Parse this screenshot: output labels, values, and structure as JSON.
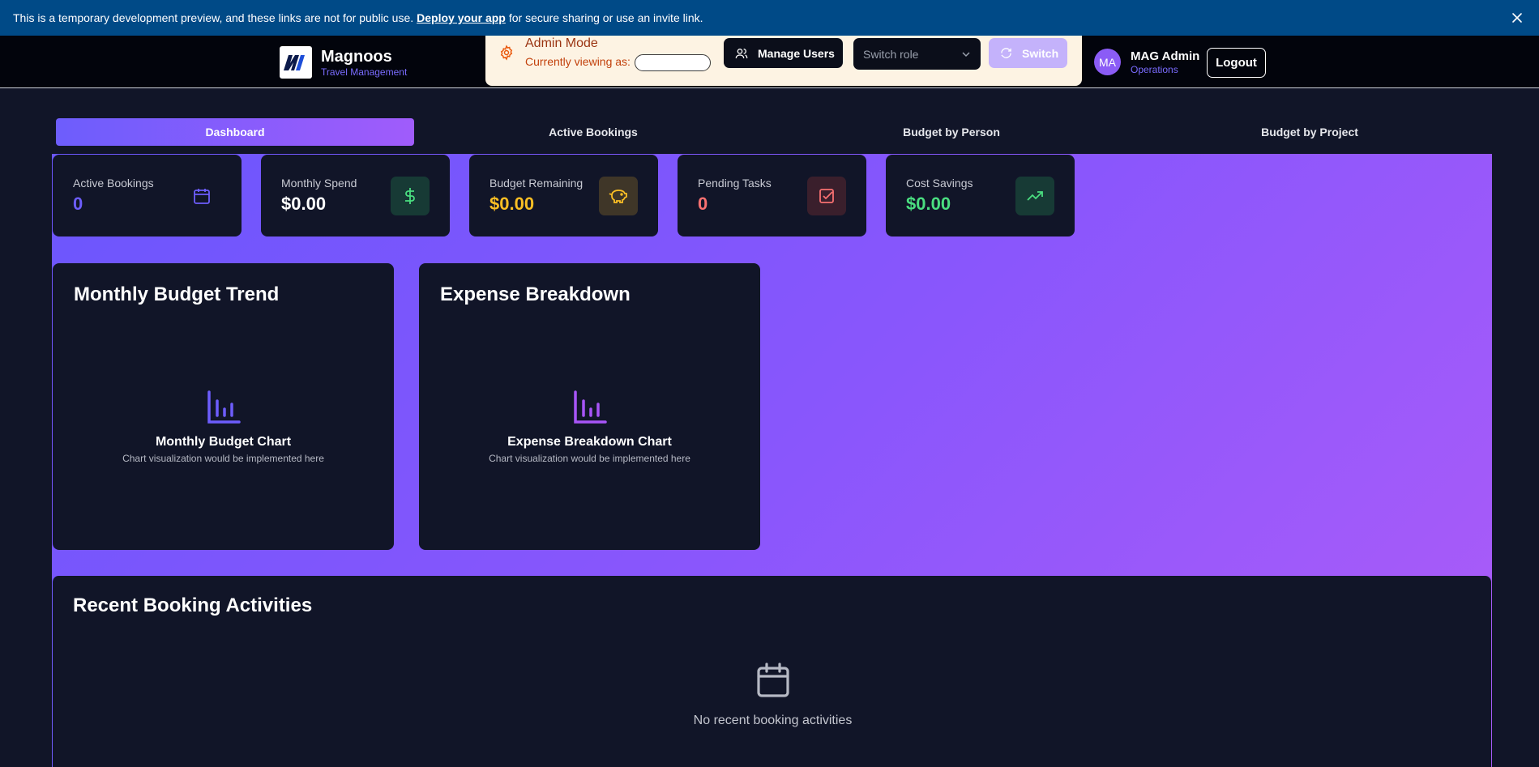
{
  "banner": {
    "text_before": "This is a temporary development preview, and these links are not for public use.",
    "link": "Deploy your app",
    "text_after": "for secure sharing or use an invite link."
  },
  "brand": {
    "name": "Magnoos",
    "subtitle": "Travel Management"
  },
  "admin": {
    "title": "Admin Mode",
    "viewing_label": "Currently viewing as:",
    "viewing_value": "",
    "manage_users": "Manage Users",
    "switch_role_placeholder": "Switch role",
    "switch_button": "Switch"
  },
  "user": {
    "initials": "MA",
    "name": "MAG Admin",
    "role": "Operations",
    "logout": "Logout"
  },
  "tabs": [
    {
      "label": "Dashboard",
      "active": true
    },
    {
      "label": "Active Bookings",
      "active": false
    },
    {
      "label": "Budget by Person",
      "active": false
    },
    {
      "label": "Budget by Project",
      "active": false
    }
  ],
  "stats": [
    {
      "label": "Active Bookings",
      "value": "0",
      "color": "#6d5dfc",
      "icon": "calendar-icon"
    },
    {
      "label": "Monthly Spend",
      "value": "$0.00",
      "color": "#ffffff",
      "icon": "dollar-icon"
    },
    {
      "label": "Budget Remaining",
      "value": "$0.00",
      "color": "#fbbf24",
      "icon": "piggy-bank-icon"
    },
    {
      "label": "Pending Tasks",
      "value": "0",
      "color": "#f87171",
      "icon": "checkbox-icon"
    },
    {
      "label": "Cost Savings",
      "value": "$0.00",
      "color": "#4ade80",
      "icon": "trending-up-icon"
    }
  ],
  "charts": [
    {
      "title": "Monthly Budget Trend",
      "name": "Monthly Budget Chart",
      "note": "Chart visualization would be implemented here"
    },
    {
      "title": "Expense Breakdown",
      "name": "Expense Breakdown Chart",
      "note": "Chart visualization would be implemented here"
    }
  ],
  "recent": {
    "title": "Recent Booking Activities",
    "empty": "No recent booking activities"
  },
  "colors": {
    "accent": "#6d5dfc",
    "accent_end": "#ad5cf8",
    "surface": "#111528",
    "banner": "#004a87"
  }
}
